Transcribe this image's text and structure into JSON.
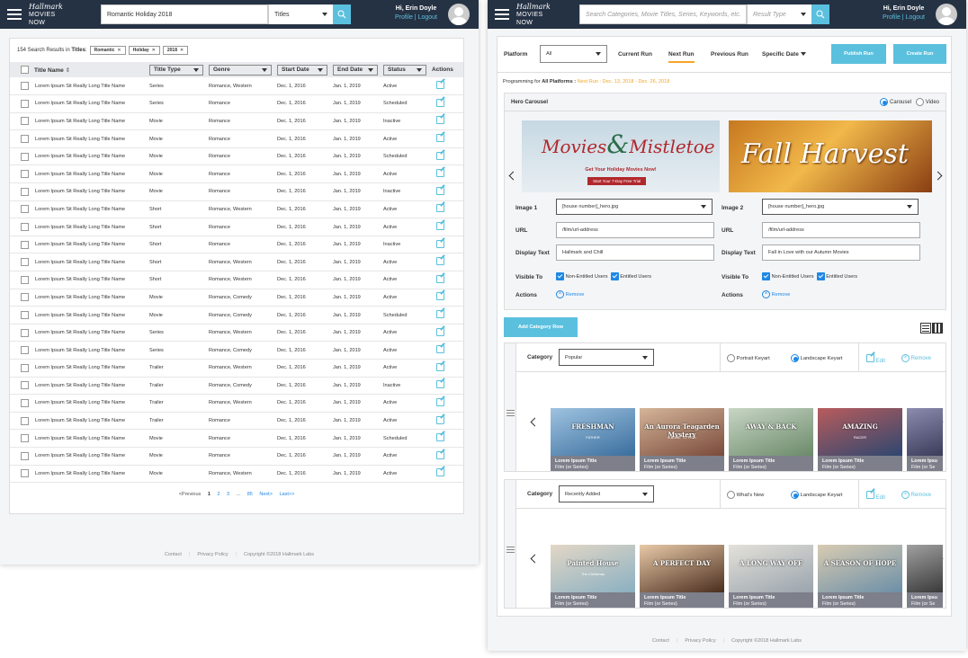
{
  "brand": {
    "name": "Hallmark",
    "sub": "MOVIES NOW"
  },
  "user": {
    "greeting": "Hi, Erin Doyle",
    "profile": "Profile",
    "sep": "|",
    "logout": "Logout"
  },
  "left": {
    "search": {
      "value": "Romantic Holiday 2018",
      "type": "Titles"
    },
    "results": {
      "count_text": "154 Search Results in",
      "scope": "Titles",
      "chips": [
        "Romantic",
        "Holiday",
        "2018"
      ]
    },
    "columns": [
      "Title Name",
      "Title Type",
      "Genre",
      "Start Date",
      "End Date",
      "Status",
      "Actions"
    ],
    "rows": [
      [
        "Lorem Ipsum Sit Really Long Title Name",
        "Series",
        "Romance, Western",
        "Dec. 1, 2016",
        "Jan. 1, 2019",
        "Active"
      ],
      [
        "Lorem Ipsum Sit Really Long Title Name",
        "Series",
        "Romance",
        "Dec. 1, 2016",
        "Jan. 1, 2019",
        "Scheduled"
      ],
      [
        "Lorem Ipsum Sit Really Long Title Name",
        "Movie",
        "Romance",
        "Dec. 1, 2016",
        "Jan. 1, 2019",
        "Inactive"
      ],
      [
        "Lorem Ipsum Sit Really Long Title Name",
        "Movie",
        "Romance",
        "Dec. 1, 2016",
        "Jan. 1, 2019",
        "Active"
      ],
      [
        "Lorem Ipsum Sit Really Long Title Name",
        "Movie",
        "Romance",
        "Dec. 1, 2016",
        "Jan. 1, 2019",
        "Scheduled"
      ],
      [
        "Lorem Ipsum Sit Really Long Title Name",
        "Movie",
        "Romance",
        "Dec. 1, 2016",
        "Jan. 1, 2019",
        "Active"
      ],
      [
        "Lorem Ipsum Sit Really Long Title Name",
        "Movie",
        "Romance",
        "Dec. 1, 2016",
        "Jan. 1, 2019",
        "Inactive"
      ],
      [
        "Lorem Ipsum Sit Really Long Title Name",
        "Short",
        "Romance, Western",
        "Dec. 1, 2016",
        "Jan. 1, 2019",
        "Active"
      ],
      [
        "Lorem Ipsum Sit Really Long Title Name",
        "Short",
        "Romance",
        "Dec. 1, 2016",
        "Jan. 1, 2019",
        "Active"
      ],
      [
        "Lorem Ipsum Sit Really Long Title Name",
        "Short",
        "Romance",
        "Dec. 1, 2016",
        "Jan. 1, 2019",
        "Inactive"
      ],
      [
        "Lorem Ipsum Sit Really Long Title Name",
        "Short",
        "Romance, Western",
        "Dec. 1, 2016",
        "Jan. 1, 2019",
        "Active"
      ],
      [
        "Lorem Ipsum Sit Really Long Title Name",
        "Short",
        "Romance, Western",
        "Dec. 1, 2016",
        "Jan. 1, 2019",
        "Active"
      ],
      [
        "Lorem Ipsum Sit Really Long Title Name",
        "Movie",
        "Romance, Comedy",
        "Dec. 1, 2016",
        "Jan. 1, 2019",
        "Active"
      ],
      [
        "Lorem Ipsum Sit Really Long Title Name",
        "Movie",
        "Romance, Comedy",
        "Dec. 1, 2016",
        "Jan. 1, 2019",
        "Scheduled"
      ],
      [
        "Lorem Ipsum Sit Really Long Title Name",
        "Series",
        "Romance, Western",
        "Dec. 1, 2016",
        "Jan. 1, 2019",
        "Active"
      ],
      [
        "Lorem Ipsum Sit Really Long Title Name",
        "Series",
        "Romance, Comedy",
        "Dec. 1, 2016",
        "Jan. 1, 2019",
        "Active"
      ],
      [
        "Lorem Ipsum Sit Really Long Title Name",
        "Trailer",
        "Romance, Western",
        "Dec. 1, 2016",
        "Jan. 1, 2019",
        "Active"
      ],
      [
        "Lorem Ipsum Sit Really Long Title Name",
        "Trailer",
        "Romance, Comedy",
        "Dec. 1, 2016",
        "Jan. 1, 2019",
        "Inactive"
      ],
      [
        "Lorem Ipsum Sit Really Long Title Name",
        "Trailer",
        "Romance, Western",
        "Dec. 1, 2016",
        "Jan. 1, 2019",
        "Active"
      ],
      [
        "Lorem Ipsum Sit Really Long Title Name",
        "Trailer",
        "Romance",
        "Dec. 1, 2016",
        "Jan. 1, 2019",
        "Active"
      ],
      [
        "Lorem Ipsum Sit Really Long Title Name",
        "Movie",
        "Romance",
        "Dec. 1, 2016",
        "Jan. 1, 2019",
        "Scheduled"
      ],
      [
        "Lorem Ipsum Sit Really Long Title Name",
        "Movie",
        "Romance",
        "Dec. 1, 2016",
        "Jan. 1, 2019",
        "Active"
      ],
      [
        "Lorem Ipsum Sit Really Long Title Name",
        "Movie",
        "Romance, Western",
        "Dec. 1, 2016",
        "Jan. 1, 2019",
        "Active"
      ]
    ],
    "pager": {
      "prev": "<Previous",
      "pages": [
        "1",
        "2",
        "3",
        "...",
        "85"
      ],
      "next": "Next>",
      "last": "Last>>"
    }
  },
  "footer": {
    "contact": "Contact",
    "privacy": "Privacy Policy",
    "copyright": "Copyright ©2018 Hallmark Labs"
  },
  "right": {
    "search": {
      "placeholder": "Search Categories, Movie Titles, Series, Keywords, etc.",
      "type": "Result Type"
    },
    "platform": {
      "label": "Platform",
      "value": "All"
    },
    "tabs": [
      "Current Run",
      "Next Run",
      "Previous Run",
      "Specific Date"
    ],
    "actions": {
      "publish": "Publish Run",
      "create": "Create Run"
    },
    "programming": {
      "prefix": "Programming for",
      "platforms": "All Platforms :",
      "run": "Next Run : Dec. 13, 2018 - Dec. 26, 2018"
    },
    "hero": {
      "title": "Hero Carousel",
      "opt_carousel": "Carousel",
      "opt_video": "Video",
      "banners": [
        {
          "line1": "Movies",
          "amp": "&",
          "line2": "Mistletoe",
          "sub": "Get Your Holiday Movies Now!",
          "cta": "Start Your 7-Day Free Trial"
        },
        {
          "line1": "Fall Harvest"
        }
      ],
      "items": [
        {
          "image_label": "Image 1",
          "image": "[house number]_hero.jpg",
          "url_label": "URL",
          "url": "/film/url-address",
          "display_label": "Display Text",
          "display": "Hallmark and Chill",
          "visible_label": "Visible To",
          "non": "Non-Entitled Users",
          "ent": "Entitled Users",
          "actions_label": "Actions",
          "remove": "Remove"
        },
        {
          "image_label": "Image 2",
          "image": "[house number]_hero.jpg",
          "url_label": "URL",
          "url": "/film/url-address",
          "display_label": "Display Text",
          "display": "Fall in Love with our Autumn Movies",
          "visible_label": "Visible To",
          "non": "Non-Entitled Users",
          "ent": "Entitled Users",
          "actions_label": "Actions",
          "remove": "Remove"
        }
      ]
    },
    "add_row": "Add Category Row",
    "categories": [
      {
        "label": "Category",
        "value": "Popular",
        "opt1": "Portrait Keyart",
        "opt2": "Landscape Keyart",
        "edit": "Edit",
        "remove": "Remove",
        "art": [
          {
            "text": "FRESHMAN",
            "sub": "FATHER"
          },
          {
            "text": "An Aurora Teagarden Mystery",
            "sub": "A BONE TO PICK"
          },
          {
            "text": "AWAY & BACK"
          },
          {
            "text": "AMAZING",
            "sub": "RACER"
          },
          {
            "text": ""
          }
        ],
        "tiles": [
          {
            "t": "Lorem Ipsum Title",
            "s": "Film (or Series)",
            "st": "Active"
          },
          {
            "t": "Lorem Ipsum Title",
            "s": "Film (or Series)",
            "st": "Active"
          },
          {
            "t": "Lorem Ipsum Title",
            "s": "Film (or Series)",
            "st": "Active"
          },
          {
            "t": "Lorem Ipsum Title",
            "s": "Film (or Series)",
            "st": "Active"
          },
          {
            "t": "Lorem Ipsu",
            "s": "Film (or Se",
            "st": "Active"
          }
        ]
      },
      {
        "label": "Category",
        "value": "Recently Added",
        "opt1": "What's New",
        "opt2": "Landscape Keyart",
        "edit": "Edit",
        "remove": "Remove",
        "art": [
          {
            "text": "Painted House",
            "sub": "The Christmas"
          },
          {
            "text": "A PERFECT DAY"
          },
          {
            "text": "A LONG WAY OFF"
          },
          {
            "text": "A SEASON OF HOPE"
          },
          {
            "text": ""
          }
        ],
        "tiles": [
          {
            "t": "Lorem Ipsum Title",
            "s": "Film (or Series)",
            "st": "Scheduled"
          },
          {
            "t": "Lorem Ipsum Title",
            "s": "Film (or Series)",
            "st": "Scheduled"
          },
          {
            "t": "Lorem Ipsum Title",
            "s": "Film (or Series)",
            "st": "Active"
          },
          {
            "t": "Lorem Ipsum Title",
            "s": "Film (or Series)",
            "st": "Scheduled"
          },
          {
            "t": "Lorem Ipsu",
            "s": "Film (or Se",
            "st": "Active"
          }
        ]
      }
    ]
  },
  "colors": {
    "topbar": "#253244",
    "accent": "#5bc0de",
    "link": "#1e88e5",
    "orange": "#f5a623"
  }
}
